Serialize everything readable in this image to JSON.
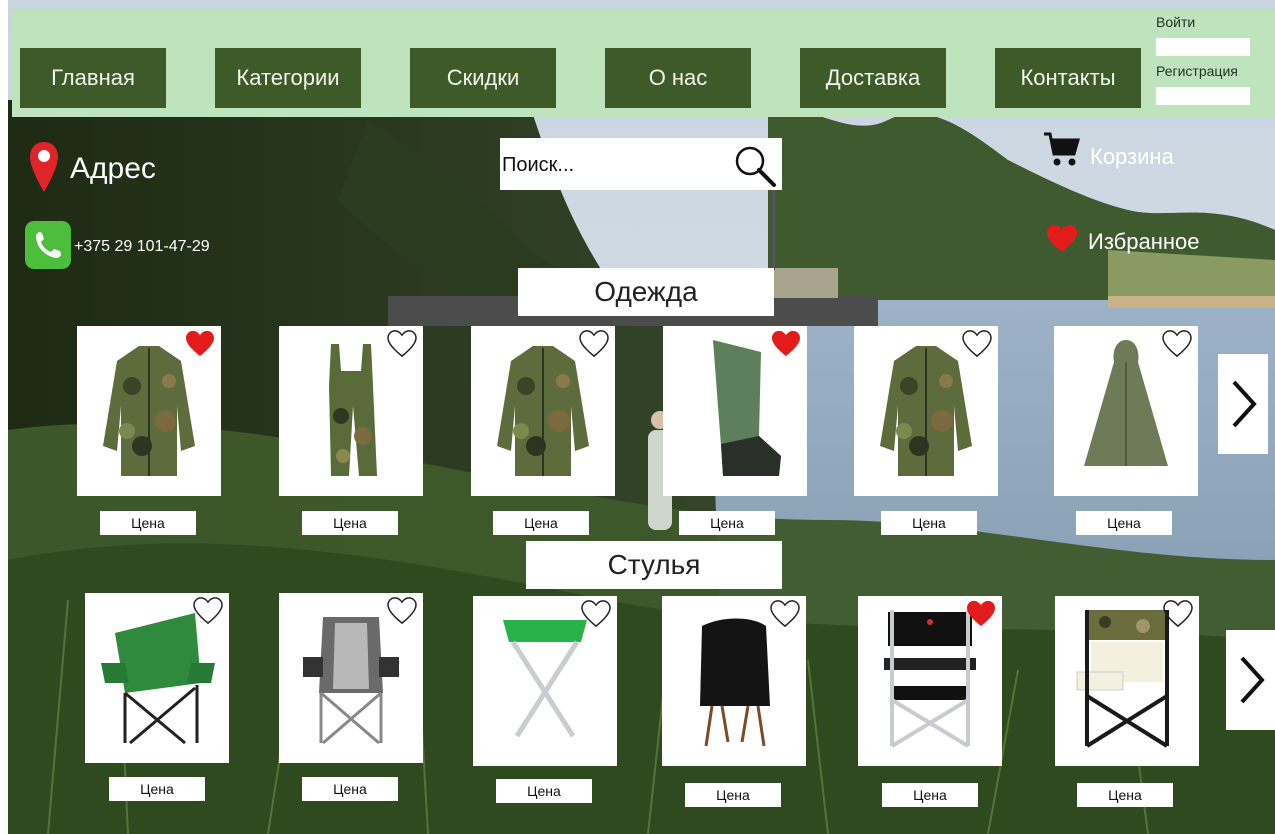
{
  "header": {
    "nav": [
      "Главная",
      "Категории",
      "Скидки",
      "О нас",
      "Доставка",
      "Контакты"
    ],
    "login_label": "Войти",
    "register_label": "Регистрация"
  },
  "contacts": {
    "address": "Адрес",
    "phone": "+375 29 101-47-29"
  },
  "search": {
    "placeholder": "Поиск..."
  },
  "actions": {
    "cart": "Корзина",
    "favorites": "Избранное"
  },
  "sections": [
    {
      "title": "Одежда",
      "items": [
        {
          "image": "camo-jacket",
          "favorited": true,
          "price_label": "Цена"
        },
        {
          "image": "camo-overalls",
          "favorited": false,
          "price_label": "Цена"
        },
        {
          "image": "camo-jacket",
          "favorited": false,
          "price_label": "Цена"
        },
        {
          "image": "rubber-boot",
          "favorited": true,
          "price_label": "Цена"
        },
        {
          "image": "camo-jacket",
          "favorited": false,
          "price_label": "Цена"
        },
        {
          "image": "olive-poncho",
          "favorited": false,
          "price_label": "Цена"
        }
      ]
    },
    {
      "title": "Стулья",
      "items": [
        {
          "image": "green-camp-chair",
          "favorited": false,
          "price_label": "Цена"
        },
        {
          "image": "grey-camp-chair",
          "favorited": false,
          "price_label": "Цена"
        },
        {
          "image": "folding-stool",
          "favorited": false,
          "price_label": "Цена"
        },
        {
          "image": "black-compact-chair",
          "favorited": false,
          "price_label": "Цена"
        },
        {
          "image": "director-chair",
          "favorited": true,
          "price_label": "Цена"
        },
        {
          "image": "camo-director-chair",
          "favorited": false,
          "price_label": "Цена"
        }
      ]
    }
  ],
  "colors": {
    "header_bg": "#bfe3bd",
    "nav_bg": "#3d5a28",
    "favorite_red": "#e21b1b",
    "phone_green": "#4dbd3c",
    "pin_red": "#e0242a"
  }
}
